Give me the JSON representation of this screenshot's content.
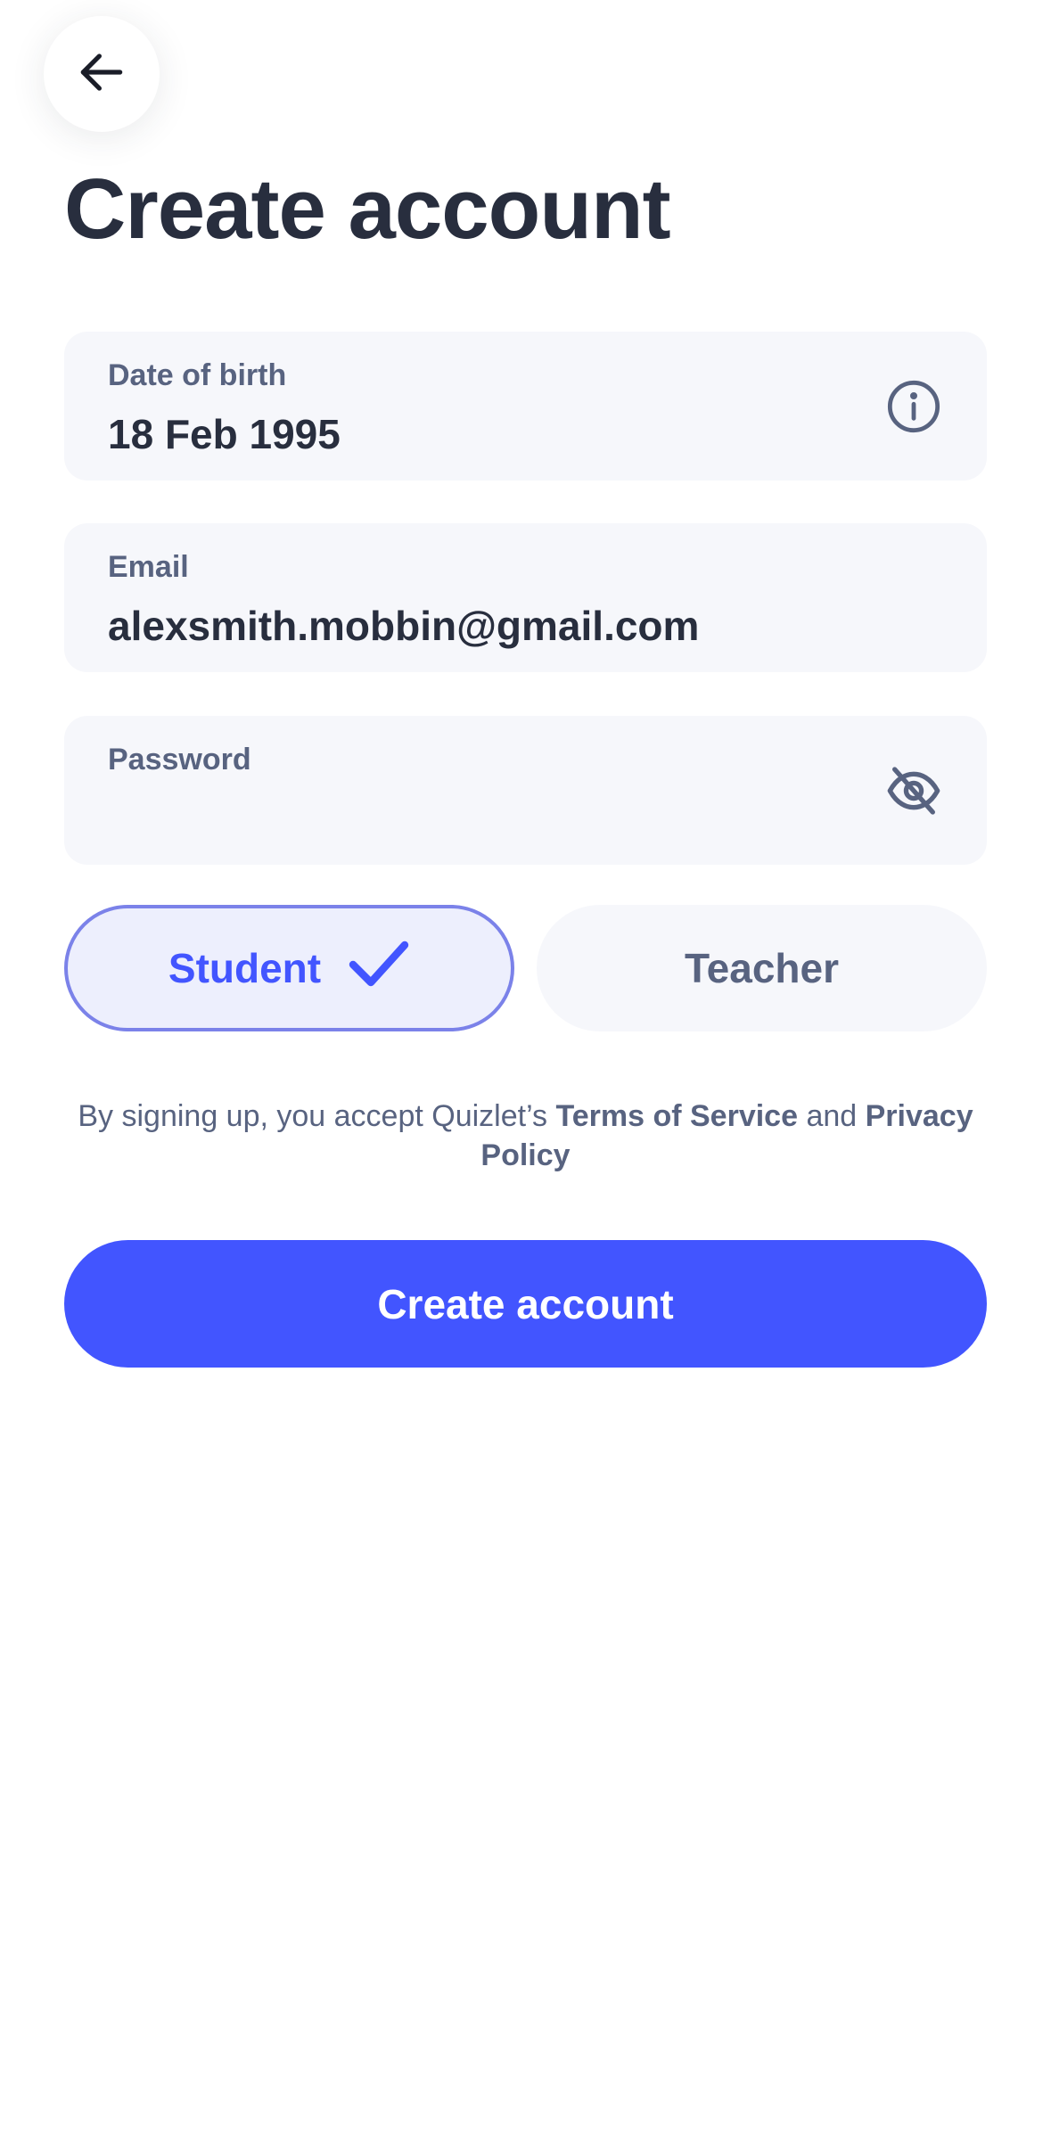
{
  "header": {
    "back_icon": "arrow-left-icon",
    "title": "Create account"
  },
  "form": {
    "dob": {
      "label": "Date of birth",
      "value": "18 Feb 1995",
      "icon": "info-icon"
    },
    "email": {
      "label": "Email",
      "value": "alexsmith.mobbin@gmail.com"
    },
    "password": {
      "label": "Password",
      "value": "",
      "icon": "eye-off-icon"
    }
  },
  "roles": {
    "student": {
      "label": "Student",
      "selected": true,
      "icon": "check-icon"
    },
    "teacher": {
      "label": "Teacher",
      "selected": false
    }
  },
  "terms": {
    "prefix": "By signing up, you accept Quizlet’s ",
    "terms_link": "Terms of Service",
    "conjunction": " and ",
    "privacy_link": "Privacy Policy"
  },
  "submit": {
    "label": "Create account"
  },
  "colors": {
    "primary": "#4255ff",
    "text_dark": "#282e3e",
    "text_muted": "#586380",
    "field_bg": "#f6f7fb",
    "selected_bg": "#edeffd",
    "selected_border": "#7b82e9"
  }
}
